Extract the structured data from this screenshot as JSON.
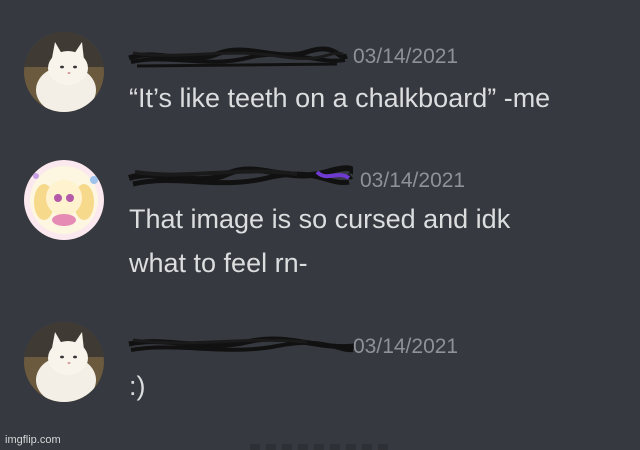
{
  "messages": [
    {
      "timestamp": "03/14/2021",
      "content": "“It’s like teeth on a chalkboard” -me",
      "avatar_icon": "white-cat-avatar"
    },
    {
      "timestamp": "03/14/2021",
      "content": "That image is so cursed and idk\nwhat to feel rn-",
      "avatar_icon": "cartoon-character-avatar"
    },
    {
      "timestamp": "03/14/2021",
      "content": ":)",
      "avatar_icon": "white-cat-avatar"
    }
  ],
  "watermark": "imgflip.com",
  "colors": {
    "background": "#36393f",
    "text": "#dcddde",
    "timestamp": "#8e9297",
    "scribble": "#111111",
    "scribble_purple": "#6f3ad0"
  }
}
